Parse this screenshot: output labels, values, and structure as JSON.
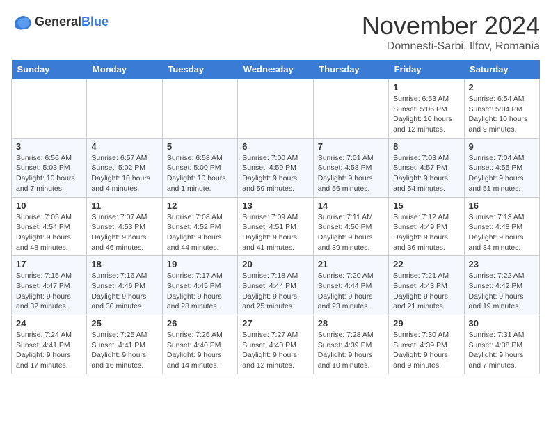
{
  "logo": {
    "general": "General",
    "blue": "Blue"
  },
  "header": {
    "month": "November 2024",
    "location": "Domnesti-Sarbi, Ilfov, Romania"
  },
  "days_of_week": [
    "Sunday",
    "Monday",
    "Tuesday",
    "Wednesday",
    "Thursday",
    "Friday",
    "Saturday"
  ],
  "weeks": [
    [
      {
        "day": "",
        "info": ""
      },
      {
        "day": "",
        "info": ""
      },
      {
        "day": "",
        "info": ""
      },
      {
        "day": "",
        "info": ""
      },
      {
        "day": "",
        "info": ""
      },
      {
        "day": "1",
        "info": "Sunrise: 6:53 AM\nSunset: 5:06 PM\nDaylight: 10 hours and 12 minutes."
      },
      {
        "day": "2",
        "info": "Sunrise: 6:54 AM\nSunset: 5:04 PM\nDaylight: 10 hours and 9 minutes."
      }
    ],
    [
      {
        "day": "3",
        "info": "Sunrise: 6:56 AM\nSunset: 5:03 PM\nDaylight: 10 hours and 7 minutes."
      },
      {
        "day": "4",
        "info": "Sunrise: 6:57 AM\nSunset: 5:02 PM\nDaylight: 10 hours and 4 minutes."
      },
      {
        "day": "5",
        "info": "Sunrise: 6:58 AM\nSunset: 5:00 PM\nDaylight: 10 hours and 1 minute."
      },
      {
        "day": "6",
        "info": "Sunrise: 7:00 AM\nSunset: 4:59 PM\nDaylight: 9 hours and 59 minutes."
      },
      {
        "day": "7",
        "info": "Sunrise: 7:01 AM\nSunset: 4:58 PM\nDaylight: 9 hours and 56 minutes."
      },
      {
        "day": "8",
        "info": "Sunrise: 7:03 AM\nSunset: 4:57 PM\nDaylight: 9 hours and 54 minutes."
      },
      {
        "day": "9",
        "info": "Sunrise: 7:04 AM\nSunset: 4:55 PM\nDaylight: 9 hours and 51 minutes."
      }
    ],
    [
      {
        "day": "10",
        "info": "Sunrise: 7:05 AM\nSunset: 4:54 PM\nDaylight: 9 hours and 48 minutes."
      },
      {
        "day": "11",
        "info": "Sunrise: 7:07 AM\nSunset: 4:53 PM\nDaylight: 9 hours and 46 minutes."
      },
      {
        "day": "12",
        "info": "Sunrise: 7:08 AM\nSunset: 4:52 PM\nDaylight: 9 hours and 44 minutes."
      },
      {
        "day": "13",
        "info": "Sunrise: 7:09 AM\nSunset: 4:51 PM\nDaylight: 9 hours and 41 minutes."
      },
      {
        "day": "14",
        "info": "Sunrise: 7:11 AM\nSunset: 4:50 PM\nDaylight: 9 hours and 39 minutes."
      },
      {
        "day": "15",
        "info": "Sunrise: 7:12 AM\nSunset: 4:49 PM\nDaylight: 9 hours and 36 minutes."
      },
      {
        "day": "16",
        "info": "Sunrise: 7:13 AM\nSunset: 4:48 PM\nDaylight: 9 hours and 34 minutes."
      }
    ],
    [
      {
        "day": "17",
        "info": "Sunrise: 7:15 AM\nSunset: 4:47 PM\nDaylight: 9 hours and 32 minutes."
      },
      {
        "day": "18",
        "info": "Sunrise: 7:16 AM\nSunset: 4:46 PM\nDaylight: 9 hours and 30 minutes."
      },
      {
        "day": "19",
        "info": "Sunrise: 7:17 AM\nSunset: 4:45 PM\nDaylight: 9 hours and 28 minutes."
      },
      {
        "day": "20",
        "info": "Sunrise: 7:18 AM\nSunset: 4:44 PM\nDaylight: 9 hours and 25 minutes."
      },
      {
        "day": "21",
        "info": "Sunrise: 7:20 AM\nSunset: 4:44 PM\nDaylight: 9 hours and 23 minutes."
      },
      {
        "day": "22",
        "info": "Sunrise: 7:21 AM\nSunset: 4:43 PM\nDaylight: 9 hours and 21 minutes."
      },
      {
        "day": "23",
        "info": "Sunrise: 7:22 AM\nSunset: 4:42 PM\nDaylight: 9 hours and 19 minutes."
      }
    ],
    [
      {
        "day": "24",
        "info": "Sunrise: 7:24 AM\nSunset: 4:41 PM\nDaylight: 9 hours and 17 minutes."
      },
      {
        "day": "25",
        "info": "Sunrise: 7:25 AM\nSunset: 4:41 PM\nDaylight: 9 hours and 16 minutes."
      },
      {
        "day": "26",
        "info": "Sunrise: 7:26 AM\nSunset: 4:40 PM\nDaylight: 9 hours and 14 minutes."
      },
      {
        "day": "27",
        "info": "Sunrise: 7:27 AM\nSunset: 4:40 PM\nDaylight: 9 hours and 12 minutes."
      },
      {
        "day": "28",
        "info": "Sunrise: 7:28 AM\nSunset: 4:39 PM\nDaylight: 9 hours and 10 minutes."
      },
      {
        "day": "29",
        "info": "Sunrise: 7:30 AM\nSunset: 4:39 PM\nDaylight: 9 hours and 9 minutes."
      },
      {
        "day": "30",
        "info": "Sunrise: 7:31 AM\nSunset: 4:38 PM\nDaylight: 9 hours and 7 minutes."
      }
    ]
  ]
}
